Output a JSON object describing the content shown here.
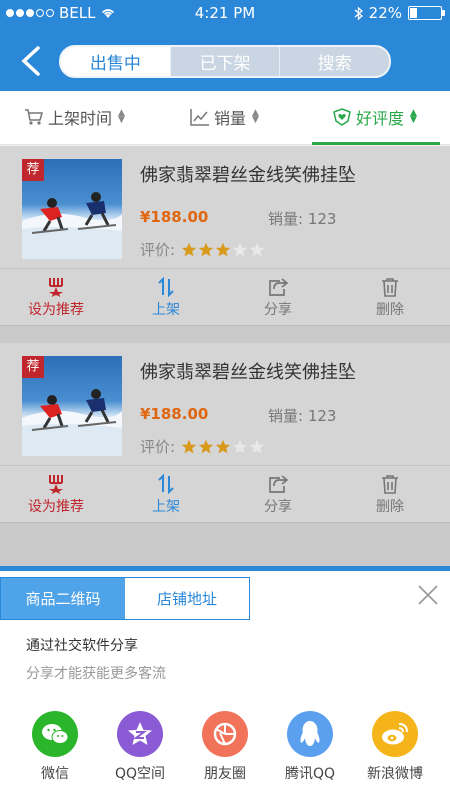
{
  "status": {
    "carrier": "BELL",
    "time": "4:21 PM",
    "battery": "22%",
    "battery_level": 0.22
  },
  "header": {
    "tabs": [
      {
        "label": "出售中",
        "active": true
      },
      {
        "label": "已下架",
        "active": false
      },
      {
        "label": "搜索",
        "active": false
      }
    ]
  },
  "sort": {
    "items": [
      {
        "label": "上架时间",
        "icon": "cart-icon"
      },
      {
        "label": "销量",
        "icon": "chart-icon"
      },
      {
        "label": "好评度",
        "icon": "heart-shield-icon",
        "active": true
      }
    ]
  },
  "products": [
    {
      "badge": "荐",
      "title": "佛家翡翠碧丝金线笑佛挂坠",
      "price": "¥188.00",
      "sales_label": "销量:",
      "sales": "123",
      "rating_label": "评价:",
      "rating": 3,
      "rating_max": 5
    },
    {
      "badge": "荐",
      "title": "佛家翡翠碧丝金线笑佛挂坠",
      "price": "¥188.00",
      "sales_label": "销量:",
      "sales": "123",
      "rating_label": "评价:",
      "rating": 3,
      "rating_max": 5
    }
  ],
  "actions": {
    "recommend": "设为推荐",
    "shelve": "上架",
    "share": "分享",
    "delete": "删除"
  },
  "share_panel": {
    "tabs": [
      {
        "label": "商品二维码",
        "active": true
      },
      {
        "label": "店铺地址",
        "active": false
      }
    ],
    "title": "通过社交软件分享",
    "subtitle": "分享才能获能更多客流",
    "targets": [
      {
        "label": "微信",
        "color": "#2bb52b",
        "icon": "wechat-icon"
      },
      {
        "label": "QQ空间",
        "color": "#8b5bd6",
        "icon": "qzone-icon"
      },
      {
        "label": "朋友圈",
        "color": "#f0735a",
        "icon": "moments-icon"
      },
      {
        "label": "腾讯QQ",
        "color": "#5ba0ee",
        "icon": "qq-icon"
      },
      {
        "label": "新浪微博",
        "color": "#f5b41a",
        "icon": "weibo-icon"
      }
    ]
  },
  "colors": {
    "primary": "#2b87d8",
    "accent_green": "#2aa84a",
    "price": "#e0660f",
    "recommend_red": "#c0262d"
  }
}
